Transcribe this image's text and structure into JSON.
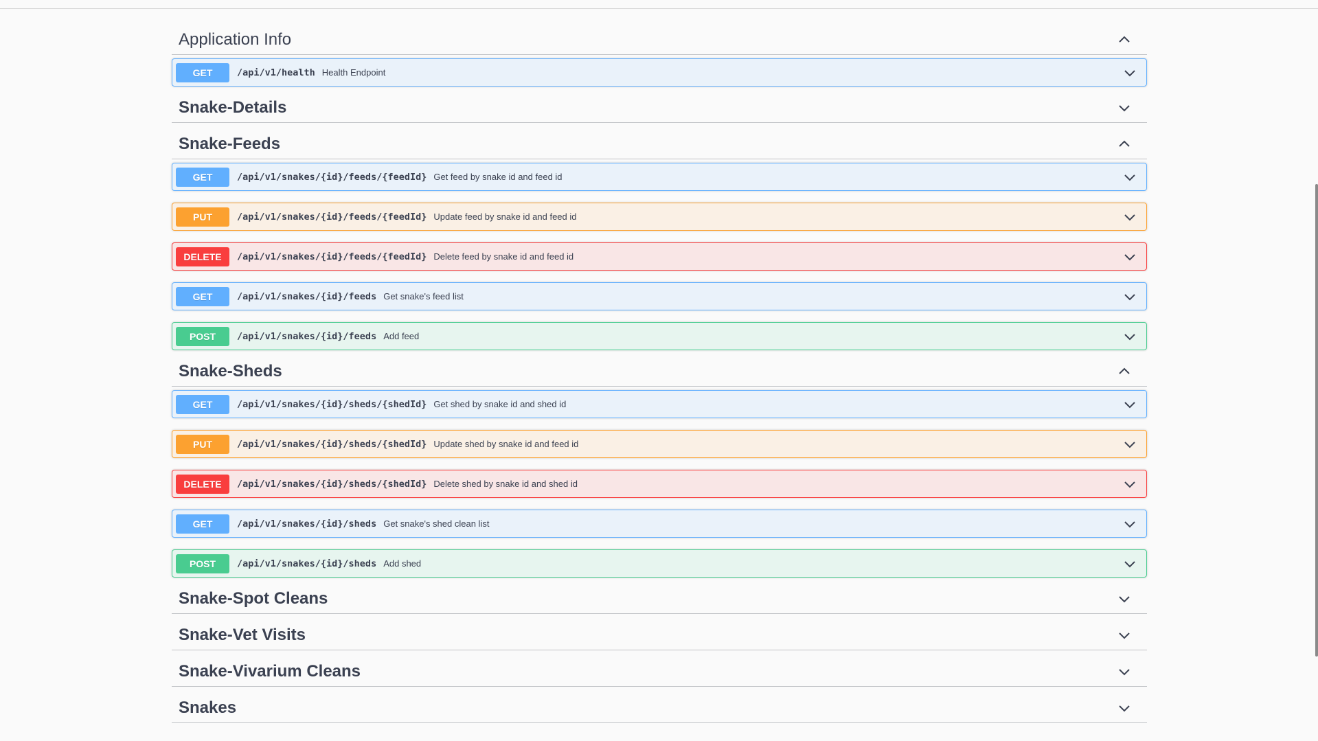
{
  "sections": [
    {
      "title": "Application Info",
      "expanded": true,
      "ops": [
        {
          "method": "GET",
          "path": "/api/v1/health",
          "summary": "Health Endpoint"
        }
      ]
    },
    {
      "title": "Snake-Details",
      "expanded": false,
      "ops": []
    },
    {
      "title": "Snake-Feeds",
      "expanded": true,
      "ops": [
        {
          "method": "GET",
          "path": "/api/v1/snakes/{id}/feeds/{feedId}",
          "summary": "Get feed by snake id and feed id"
        },
        {
          "method": "PUT",
          "path": "/api/v1/snakes/{id}/feeds/{feedId}",
          "summary": "Update feed by snake id and feed id"
        },
        {
          "method": "DELETE",
          "path": "/api/v1/snakes/{id}/feeds/{feedId}",
          "summary": "Delete feed by snake id and feed id"
        },
        {
          "method": "GET",
          "path": "/api/v1/snakes/{id}/feeds",
          "summary": "Get snake's feed list"
        },
        {
          "method": "POST",
          "path": "/api/v1/snakes/{id}/feeds",
          "summary": "Add feed"
        }
      ]
    },
    {
      "title": "Snake-Sheds",
      "expanded": true,
      "ops": [
        {
          "method": "GET",
          "path": "/api/v1/snakes/{id}/sheds/{shedId}",
          "summary": "Get shed by snake id and shed id"
        },
        {
          "method": "PUT",
          "path": "/api/v1/snakes/{id}/sheds/{shedId}",
          "summary": "Update shed by snake id and feed id"
        },
        {
          "method": "DELETE",
          "path": "/api/v1/snakes/{id}/sheds/{shedId}",
          "summary": "Delete shed by snake id and shed id"
        },
        {
          "method": "GET",
          "path": "/api/v1/snakes/{id}/sheds",
          "summary": "Get snake's shed clean list"
        },
        {
          "method": "POST",
          "path": "/api/v1/snakes/{id}/sheds",
          "summary": "Add shed"
        }
      ]
    },
    {
      "title": "Snake-Spot Cleans",
      "expanded": false,
      "ops": []
    },
    {
      "title": "Snake-Vet Visits",
      "expanded": false,
      "ops": []
    },
    {
      "title": "Snake-Vivarium Cleans",
      "expanded": false,
      "ops": []
    },
    {
      "title": "Snakes",
      "expanded": false,
      "ops": []
    }
  ],
  "icons": {
    "expanded": "chevron-up-icon",
    "collapsed": "chevron-down-icon",
    "operation": "chevron-down-icon"
  },
  "colors": {
    "GET": "#61affe",
    "PUT": "#fca130",
    "DELETE": "#f93e3e",
    "POST": "#49cc90"
  }
}
